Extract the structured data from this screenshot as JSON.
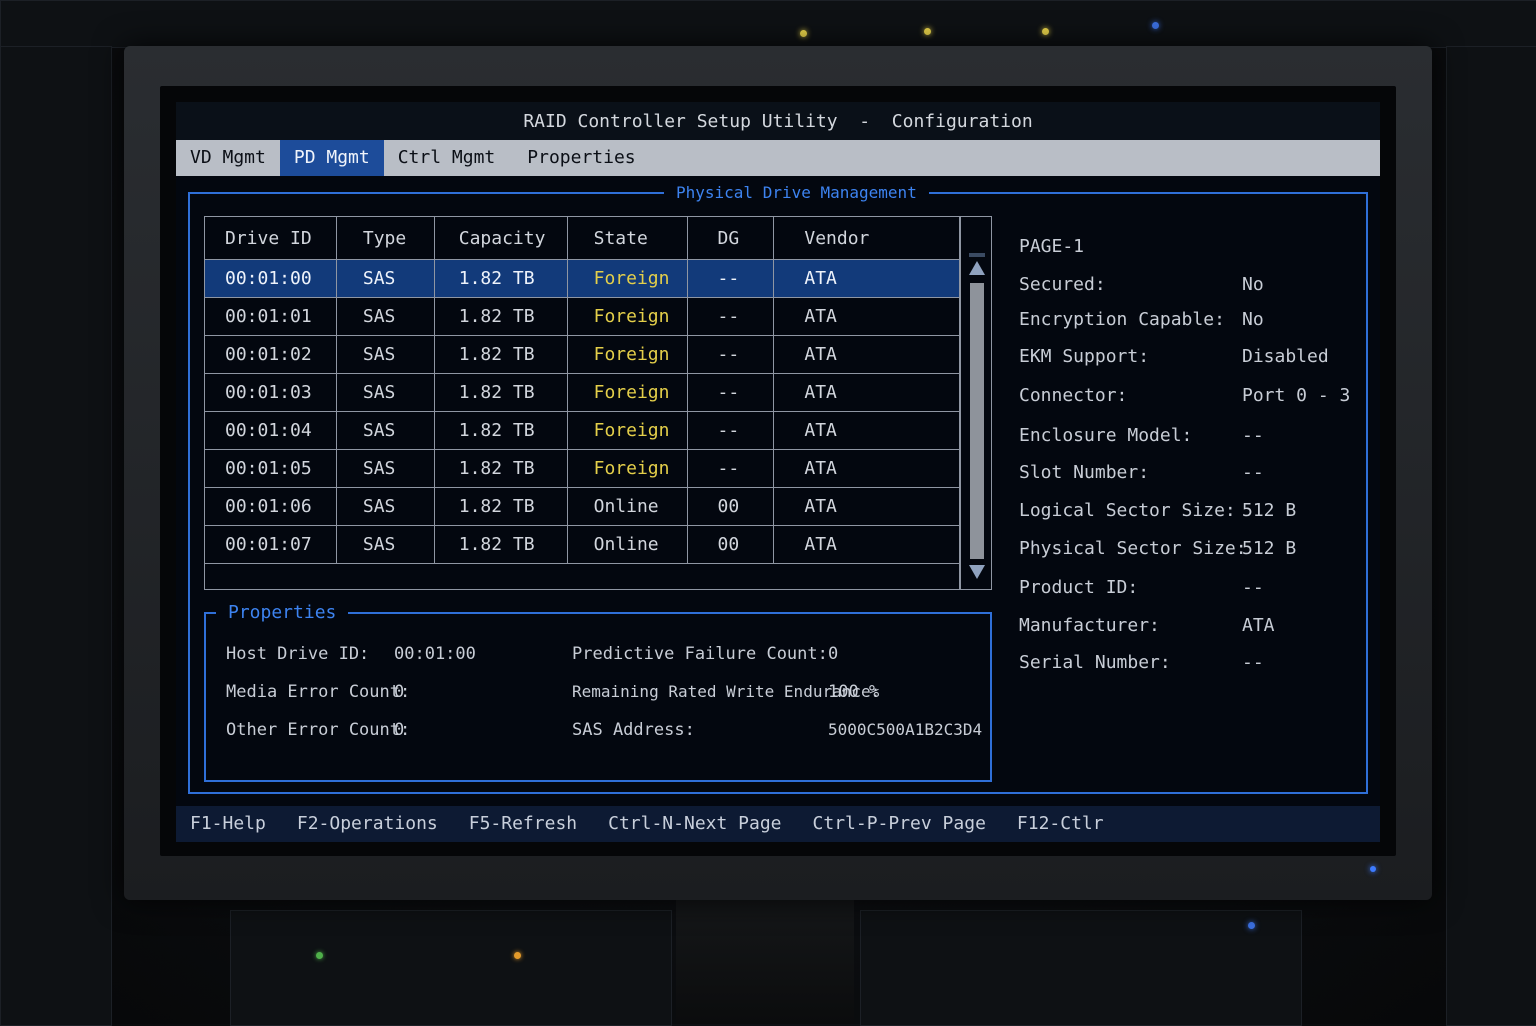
{
  "window": {
    "title": "RAID Controller Setup Utility  -  Configuration"
  },
  "menu": {
    "items": [
      {
        "label": "VD Mgmt",
        "active": false
      },
      {
        "label": "PD Mgmt",
        "active": true
      },
      {
        "label": "Ctrl Mgmt",
        "active": false
      },
      {
        "label": "Properties",
        "active": false
      }
    ]
  },
  "main": {
    "title": "Physical Drive Management",
    "table": {
      "headers": [
        "Drive ID",
        "Type",
        "Capacity",
        "State",
        "DG",
        "Vendor"
      ],
      "rows": [
        {
          "drive_id": "00:01:00",
          "type": "SAS",
          "capacity": "1.82 TB",
          "state": "Foreign",
          "dg": "--",
          "vendor": "ATA"
        },
        {
          "drive_id": "00:01:01",
          "type": "SAS",
          "capacity": "1.82 TB",
          "state": "Foreign",
          "dg": "--",
          "vendor": "ATA"
        },
        {
          "drive_id": "00:01:02",
          "type": "SAS",
          "capacity": "1.82 TB",
          "state": "Foreign",
          "dg": "--",
          "vendor": "ATA"
        },
        {
          "drive_id": "00:01:03",
          "type": "SAS",
          "capacity": "1.82 TB",
          "state": "Foreign",
          "dg": "--",
          "vendor": "ATA"
        },
        {
          "drive_id": "00:01:04",
          "type": "SAS",
          "capacity": "1.82 TB",
          "state": "Foreign",
          "dg": "--",
          "vendor": "ATA"
        },
        {
          "drive_id": "00:01:05",
          "type": "SAS",
          "capacity": "1.82 TB",
          "state": "Foreign",
          "dg": "--",
          "vendor": "ATA"
        },
        {
          "drive_id": "00:01:06",
          "type": "SAS",
          "capacity": "1.82 TB",
          "state": "Online",
          "dg": "00",
          "vendor": "ATA"
        },
        {
          "drive_id": "00:01:07",
          "type": "SAS",
          "capacity": "1.82 TB",
          "state": "Online",
          "dg": "00",
          "vendor": "ATA"
        }
      ],
      "selected_index": 0
    },
    "properties": {
      "title": "Properties",
      "host_drive_id_label": "Host Drive ID:",
      "host_drive_id_value": "00:01:00",
      "media_error_label": "Media Error Count:",
      "media_error_value": "0",
      "other_error_label": "Other Error Count:",
      "other_error_value": "0",
      "predictive_failure_label": "Predictive Failure Count:",
      "predictive_failure_value": "0",
      "write_endurance_label": "Remaining Rated Write Endurance:",
      "write_endurance_value": "100 %",
      "sas_address_label": "SAS Address:",
      "sas_address_value": "5000C500A1B2C3D4"
    }
  },
  "side_panel": {
    "page": "PAGE-1",
    "fields": [
      {
        "label": "Secured:",
        "value": "No"
      },
      {
        "label": "Encryption Capable:",
        "value": "No"
      },
      {
        "label": "EKM Support:",
        "value": "Disabled"
      },
      {
        "label": "Connector:",
        "value": "Port 0 - 3"
      },
      {
        "label": "Enclosure Model:",
        "value": "--"
      },
      {
        "label": "Slot Number:",
        "value": "--"
      },
      {
        "label": "Logical Sector Size:",
        "value": "512 B"
      },
      {
        "label": "Physical Sector Size:",
        "value": "512 B"
      },
      {
        "label": "Product ID:",
        "value": "--"
      },
      {
        "label": "Manufacturer:",
        "value": "ATA"
      },
      {
        "label": "Serial Number:",
        "value": "--"
      }
    ]
  },
  "footer": {
    "keys": [
      "F1-Help",
      "F2-Operations",
      "F5-Refresh",
      "Ctrl-N-Next Page",
      "Ctrl-P-Prev Page",
      "F12-Ctlr"
    ]
  },
  "colors": {
    "accent_blue": "#2f6fd8",
    "selected_row": "#123a7a",
    "foreign_state": "#e4cf4a",
    "menubar": "#b9bec6",
    "power_led": "#3d7bff"
  }
}
